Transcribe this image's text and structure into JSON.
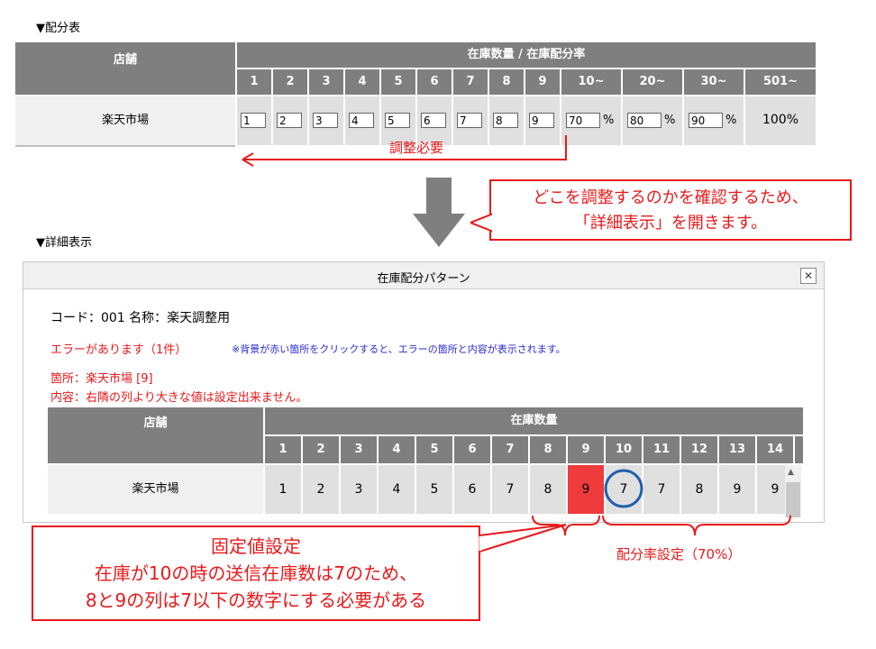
{
  "top": {
    "section_label": "▼配分表",
    "store_header": "店舗",
    "qty_header": "在庫数量 / 在庫配分率",
    "columns": [
      "1",
      "2",
      "3",
      "4",
      "5",
      "6",
      "7",
      "8",
      "9",
      "10~",
      "20~",
      "30~",
      "501~"
    ],
    "row_label": "楽天市場",
    "inputs": [
      "1",
      "2",
      "3",
      "4",
      "5",
      "6",
      "7",
      "8",
      "9",
      "70",
      "80",
      "90"
    ],
    "pct_symbol": "%",
    "last_value": "100%",
    "adjust_label": "調整必要"
  },
  "callout_top": {
    "line1": "どこを調整するのかを確認するため、",
    "line2": "「詳細表示」を開きます。"
  },
  "detail": {
    "section_label": "▼詳細表示",
    "dialog_title": "在庫配分パターン",
    "close_symbol": "✕",
    "code_line": "コード：001  名称：楽天調整用",
    "error_title": "エラーがあります（1件）",
    "error_hint": "※背景が赤い箇所をクリックすると、エラーの箇所と内容が表示されます。",
    "location_line": "箇所：楽天市場 [9]",
    "content_line": "内容：右隣の列より大きな値は設定出来ません。",
    "store_header": "店舗",
    "qty_header": "在庫数量",
    "columns": [
      "1",
      "2",
      "3",
      "4",
      "5",
      "6",
      "7",
      "8",
      "9",
      "10",
      "11",
      "12",
      "13",
      "14"
    ],
    "row_label": "楽天市場",
    "values": [
      "1",
      "2",
      "3",
      "4",
      "5",
      "6",
      "7",
      "8",
      "9",
      "7",
      "7",
      "8",
      "9",
      "9"
    ],
    "error_color": "#ef3b3b",
    "circle_color": "#1f5fa8"
  },
  "bottom": {
    "callout_title": "固定値設定",
    "callout_line2": "在庫が10の時の送信在庫数は7のため、",
    "callout_line3": "8と9の列は7以下の数字にする必要がある",
    "ratio_label": "配分率設定（70%）"
  },
  "accent_red": "#e8191b",
  "header_grey": "#7f7f7f"
}
